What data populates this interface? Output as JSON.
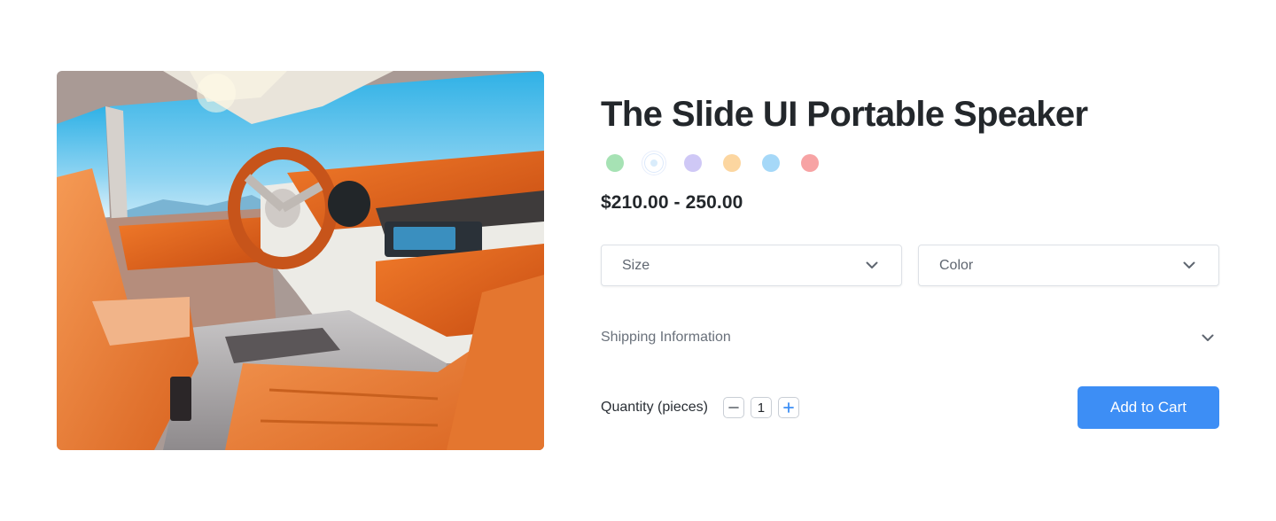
{
  "product": {
    "title": "The Slide UI Portable Speaker",
    "image_icon": "car-interior-photo",
    "swatches": [
      {
        "name": "green",
        "color": "#a6e2b4"
      },
      {
        "name": "white",
        "color": "#ffffff",
        "selected": true
      },
      {
        "name": "lavender",
        "color": "#cfc8f6"
      },
      {
        "name": "peach",
        "color": "#fcd6a0"
      },
      {
        "name": "sky-blue",
        "color": "#a5d8f8"
      },
      {
        "name": "coral",
        "color": "#f7a3a4"
      }
    ],
    "price": "$210.00 - 250.00"
  },
  "options": {
    "size_label": "Size",
    "color_label": "Color",
    "chevron_icon": "chevron-down-icon"
  },
  "shipping": {
    "label": "Shipping Information"
  },
  "quantity": {
    "label": "Quantity (pieces)",
    "value": "1",
    "decrement_icon": "minus-icon",
    "increment_icon": "plus-icon"
  },
  "cart": {
    "button_label": "Add to Cart",
    "button_color": "#3d8ef5"
  }
}
